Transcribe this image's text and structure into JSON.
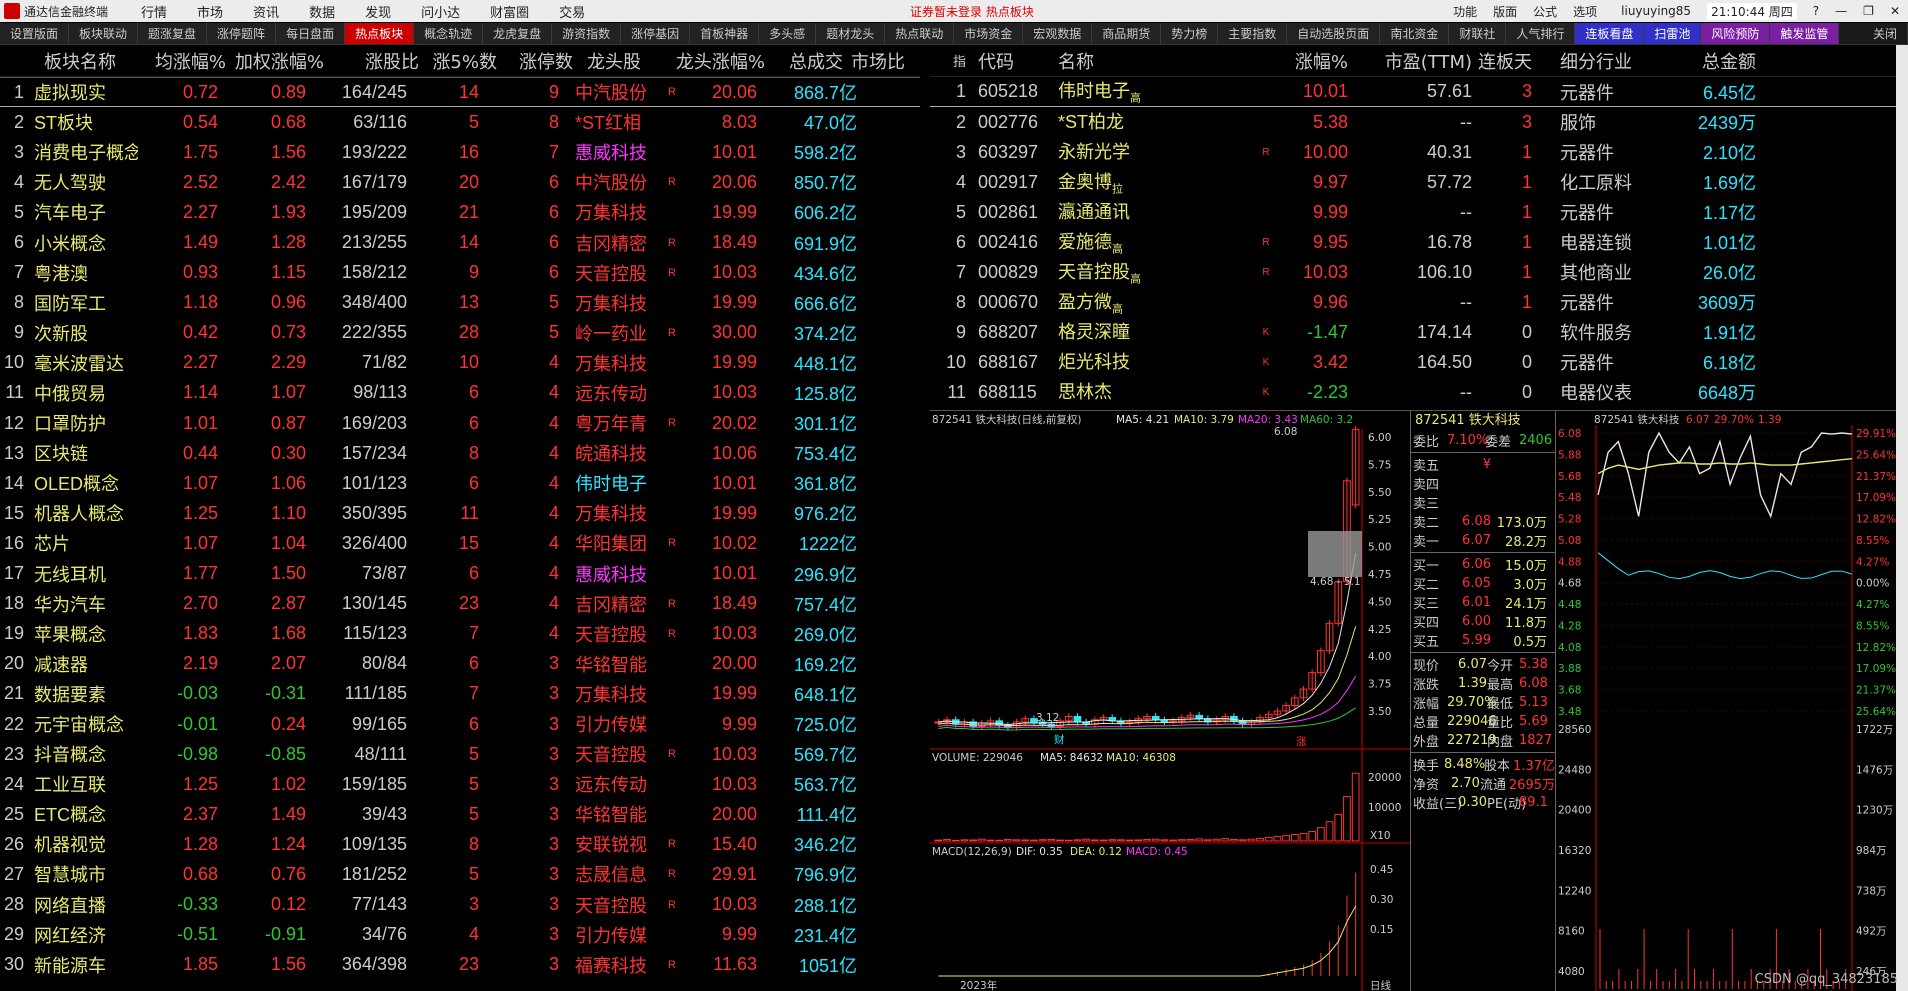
{
  "app": {
    "title": "通达信金融终端",
    "notice": "证券暂未登录  热点板块",
    "user": "liuyuying85",
    "clock": "21:10:44 周四",
    "menus": [
      "行情",
      "市场",
      "资讯",
      "数据",
      "发现",
      "问小达",
      "财富圈",
      "交易"
    ],
    "right_menus": [
      "功能",
      "版面",
      "公式",
      "选项"
    ]
  },
  "tabs": [
    "设置版面",
    "板块联动",
    "题涨复盘",
    "涨停题阵",
    "每日盘面",
    "热点板块",
    "概念轨迹",
    "龙虎复盘",
    "游资指数",
    "涨停基因",
    "首板神器",
    "多头感",
    "题材龙头",
    "热点联动",
    "市场资金",
    "宏观数据",
    "商品期货",
    "势力榜",
    "主要指数",
    "自动选股页面",
    "南北资金",
    "财联社",
    "人气排行",
    "连板看盘",
    "扫雷池",
    "风险预防",
    "触发监管",
    "关闭"
  ],
  "left": {
    "headers": {
      "name": "板块名称",
      "avg": "均涨幅%",
      "w": "加权涨幅%",
      "ratio": "涨股比",
      "z5": "涨5%数",
      "zt": "涨停数",
      "leader": "龙头股",
      "lz": "龙头涨幅%",
      "amt": "总成交",
      "extra": "市场比"
    },
    "rows": [
      {
        "i": "1",
        "n": "虚拟现实",
        "a": "0.72",
        "w": "0.89",
        "r": "164/245",
        "z5": "14",
        "zt": "9",
        "l": "中汽股份",
        "m": "R",
        "lz": "20.06",
        "amt": "868.7亿"
      },
      {
        "i": "2",
        "n": "ST板块",
        "a": "0.54",
        "w": "0.68",
        "r": "63/116",
        "z5": "5",
        "zt": "8",
        "l": "*ST红相",
        "m": "",
        "lz": "8.03",
        "amt": "47.0亿"
      },
      {
        "i": "3",
        "n": "消费电子概念",
        "a": "1.75",
        "w": "1.56",
        "r": "193/222",
        "z5": "16",
        "zt": "7",
        "l": "惠威科技",
        "m": "",
        "lz": "10.01",
        "amt": "598.2亿"
      },
      {
        "i": "4",
        "n": "无人驾驶",
        "a": "2.52",
        "w": "2.42",
        "r": "167/179",
        "z5": "20",
        "zt": "6",
        "l": "中汽股份",
        "m": "R",
        "lz": "20.06",
        "amt": "850.7亿"
      },
      {
        "i": "5",
        "n": "汽车电子",
        "a": "2.27",
        "w": "1.93",
        "r": "195/209",
        "z5": "21",
        "zt": "6",
        "l": "万集科技",
        "m": "",
        "lz": "19.99",
        "amt": "606.2亿"
      },
      {
        "i": "6",
        "n": "小米概念",
        "a": "1.49",
        "w": "1.28",
        "r": "213/255",
        "z5": "14",
        "zt": "6",
        "l": "吉冈精密",
        "m": "R",
        "lz": "18.49",
        "amt": "691.9亿"
      },
      {
        "i": "7",
        "n": "粤港澳",
        "a": "0.93",
        "w": "1.15",
        "r": "158/212",
        "z5": "9",
        "zt": "6",
        "l": "天音控股",
        "m": "R",
        "lz": "10.03",
        "amt": "434.6亿"
      },
      {
        "i": "8",
        "n": "国防军工",
        "a": "1.18",
        "w": "0.96",
        "r": "348/400",
        "z5": "13",
        "zt": "5",
        "l": "万集科技",
        "m": "",
        "lz": "19.99",
        "amt": "666.6亿"
      },
      {
        "i": "9",
        "n": "次新股",
        "a": "0.42",
        "w": "0.73",
        "r": "222/355",
        "z5": "28",
        "zt": "5",
        "l": "岭一药业",
        "m": "R",
        "lz": "30.00",
        "amt": "374.2亿"
      },
      {
        "i": "10",
        "n": "毫米波雷达",
        "a": "2.27",
        "w": "2.29",
        "r": "71/82",
        "z5": "10",
        "zt": "4",
        "l": "万集科技",
        "m": "",
        "lz": "19.99",
        "amt": "448.1亿"
      },
      {
        "i": "11",
        "n": "中俄贸易",
        "a": "1.14",
        "w": "1.07",
        "r": "98/113",
        "z5": "6",
        "zt": "4",
        "l": "远东传动",
        "m": "",
        "lz": "10.03",
        "amt": "125.8亿"
      },
      {
        "i": "12",
        "n": "口罩防护",
        "a": "1.01",
        "w": "0.87",
        "r": "169/203",
        "z5": "6",
        "zt": "4",
        "l": "粤万年青",
        "m": "R",
        "lz": "20.02",
        "amt": "301.1亿"
      },
      {
        "i": "13",
        "n": "区块链",
        "a": "0.44",
        "w": "0.30",
        "r": "157/234",
        "z5": "8",
        "zt": "4",
        "l": "皖通科技",
        "m": "",
        "lz": "10.06",
        "amt": "753.4亿"
      },
      {
        "i": "14",
        "n": "OLED概念",
        "a": "1.07",
        "w": "1.06",
        "r": "101/123",
        "z5": "6",
        "zt": "4",
        "l": "伟时电子",
        "m": "",
        "lz": "10.01",
        "amt": "361.8亿"
      },
      {
        "i": "15",
        "n": "机器人概念",
        "a": "1.25",
        "w": "1.10",
        "r": "350/395",
        "z5": "11",
        "zt": "4",
        "l": "万集科技",
        "m": "",
        "lz": "19.99",
        "amt": "976.2亿"
      },
      {
        "i": "16",
        "n": "芯片",
        "a": "1.07",
        "w": "1.04",
        "r": "326/400",
        "z5": "15",
        "zt": "4",
        "l": "华阳集团",
        "m": "R",
        "lz": "10.02",
        "amt": "1222亿"
      },
      {
        "i": "17",
        "n": "无线耳机",
        "a": "1.77",
        "w": "1.50",
        "r": "73/87",
        "z5": "6",
        "zt": "4",
        "l": "惠威科技",
        "m": "",
        "lz": "10.01",
        "amt": "296.9亿"
      },
      {
        "i": "18",
        "n": "华为汽车",
        "a": "2.70",
        "w": "2.87",
        "r": "130/145",
        "z5": "23",
        "zt": "4",
        "l": "吉冈精密",
        "m": "R",
        "lz": "18.49",
        "amt": "757.4亿"
      },
      {
        "i": "19",
        "n": "苹果概念",
        "a": "1.83",
        "w": "1.68",
        "r": "115/123",
        "z5": "7",
        "zt": "4",
        "l": "天音控股",
        "m": "R",
        "lz": "10.03",
        "amt": "269.0亿"
      },
      {
        "i": "20",
        "n": "减速器",
        "a": "2.19",
        "w": "2.07",
        "r": "80/84",
        "z5": "6",
        "zt": "3",
        "l": "华铭智能",
        "m": "",
        "lz": "20.00",
        "amt": "169.2亿"
      },
      {
        "i": "21",
        "n": "数据要素",
        "a": "-0.03",
        "w": "-0.31",
        "r": "111/185",
        "z5": "7",
        "zt": "3",
        "l": "万集科技",
        "m": "",
        "lz": "19.99",
        "amt": "648.1亿"
      },
      {
        "i": "22",
        "n": "元宇宙概念",
        "a": "-0.01",
        "w": "0.24",
        "r": "99/165",
        "z5": "6",
        "zt": "3",
        "l": "引力传媒",
        "m": "",
        "lz": "9.99",
        "amt": "725.0亿"
      },
      {
        "i": "23",
        "n": "抖音概念",
        "a": "-0.98",
        "w": "-0.85",
        "r": "48/111",
        "z5": "5",
        "zt": "3",
        "l": "天音控股",
        "m": "R",
        "lz": "10.03",
        "amt": "569.7亿"
      },
      {
        "i": "24",
        "n": "工业互联",
        "a": "1.25",
        "w": "1.02",
        "r": "159/185",
        "z5": "5",
        "zt": "3",
        "l": "远东传动",
        "m": "",
        "lz": "10.03",
        "amt": "563.7亿"
      },
      {
        "i": "25",
        "n": "ETC概念",
        "a": "2.37",
        "w": "1.49",
        "r": "39/43",
        "z5": "5",
        "zt": "3",
        "l": "华铭智能",
        "m": "",
        "lz": "20.00",
        "amt": "111.4亿"
      },
      {
        "i": "26",
        "n": "机器视觉",
        "a": "1.28",
        "w": "1.24",
        "r": "109/135",
        "z5": "8",
        "zt": "3",
        "l": "安联锐视",
        "m": "R",
        "lz": "15.40",
        "amt": "346.2亿"
      },
      {
        "i": "27",
        "n": "智慧城市",
        "a": "0.68",
        "w": "0.76",
        "r": "181/252",
        "z5": "5",
        "zt": "3",
        "l": "志晟信息",
        "m": "R",
        "lz": "29.91",
        "amt": "796.9亿"
      },
      {
        "i": "28",
        "n": "网络直播",
        "a": "-0.33",
        "w": "0.12",
        "r": "77/143",
        "z5": "3",
        "zt": "3",
        "l": "天音控股",
        "m": "R",
        "lz": "10.03",
        "amt": "288.1亿"
      },
      {
        "i": "29",
        "n": "网红经济",
        "a": "-0.51",
        "w": "-0.91",
        "r": "34/76",
        "z5": "4",
        "zt": "3",
        "l": "引力传媒",
        "m": "",
        "lz": "9.99",
        "amt": "231.4亿"
      },
      {
        "i": "30",
        "n": "新能源车",
        "a": "1.85",
        "w": "1.56",
        "r": "364/398",
        "z5": "23",
        "zt": "3",
        "l": "福赛科技",
        "m": "R",
        "lz": "11.63",
        "amt": "1051亿"
      }
    ]
  },
  "right": {
    "headers": {
      "idx": "指",
      "code": "代码",
      "name": "名称",
      "chg": "涨幅%",
      "pe": "市盈(TTM)",
      "days": "连板天",
      "ind": "细分行业",
      "amt": "总金额"
    },
    "rows": [
      {
        "i": "1",
        "code": "605218",
        "n": "伟时电子",
        "sub": "高",
        "m": "",
        "chg": "10.01",
        "pe": "57.61",
        "d": "3",
        "ind": "元器件",
        "amt": "6.45亿"
      },
      {
        "i": "2",
        "code": "002776",
        "n": "*ST柏龙",
        "sub": "",
        "m": "",
        "chg": "5.38",
        "pe": "--",
        "d": "3",
        "ind": "服饰",
        "amt": "2439万"
      },
      {
        "i": "3",
        "code": "603297",
        "n": "永新光学",
        "sub": "",
        "m": "R",
        "chg": "10.00",
        "pe": "40.31",
        "d": "1",
        "ind": "元器件",
        "amt": "2.10亿"
      },
      {
        "i": "4",
        "code": "002917",
        "n": "金奥博",
        "sub": "拉",
        "m": "",
        "chg": "9.97",
        "pe": "57.72",
        "d": "1",
        "ind": "化工原料",
        "amt": "1.69亿"
      },
      {
        "i": "5",
        "code": "002861",
        "n": "瀛通通讯",
        "sub": "",
        "m": "",
        "chg": "9.99",
        "pe": "--",
        "d": "1",
        "ind": "元器件",
        "amt": "1.17亿"
      },
      {
        "i": "6",
        "code": "002416",
        "n": "爱施德",
        "sub": "高",
        "m": "R",
        "chg": "9.95",
        "pe": "16.78",
        "d": "1",
        "ind": "电器连锁",
        "amt": "1.01亿"
      },
      {
        "i": "7",
        "code": "000829",
        "n": "天音控股",
        "sub": "高",
        "m": "R",
        "chg": "10.03",
        "pe": "106.10",
        "d": "1",
        "ind": "其他商业",
        "amt": "26.0亿"
      },
      {
        "i": "8",
        "code": "000670",
        "n": "盈方微",
        "sub": "高",
        "m": "",
        "chg": "9.96",
        "pe": "--",
        "d": "1",
        "ind": "元器件",
        "amt": "3609万"
      },
      {
        "i": "9",
        "code": "688207",
        "n": "格灵深瞳",
        "sub": "",
        "m": "K",
        "chg": "-1.47",
        "pe": "174.14",
        "d": "0",
        "ind": "软件服务",
        "amt": "1.91亿"
      },
      {
        "i": "10",
        "code": "688167",
        "n": "炬光科技",
        "sub": "",
        "m": "K",
        "chg": "3.42",
        "pe": "164.50",
        "d": "0",
        "ind": "元器件",
        "amt": "6.18亿"
      },
      {
        "i": "11",
        "code": "688115",
        "n": "思林杰",
        "sub": "",
        "m": "K",
        "chg": "-2.23",
        "pe": "--",
        "d": "0",
        "ind": "电器仪表",
        "amt": "6648万"
      }
    ]
  },
  "kline": {
    "title": "872541 铁大科技(日线,前复权)",
    "ma5": "MA5: 4.21",
    "ma10": "MA10: 3.79",
    "ma20": "MA20: 3.43",
    "ma60": "MA60: 3.2",
    "yticks": [
      "6.00",
      "5.75",
      "5.50",
      "5.25",
      "5.00",
      "4.75",
      "4.50",
      "4.25",
      "4.00",
      "3.75",
      "3.50"
    ],
    "high_label": "6.08",
    "low_label": "3.12",
    "box_label": "4.68 - 5.1",
    "marker_cai": "财",
    "marker_zhang": "涨",
    "vol_title": "VOLUME: 229046",
    "vol_ma5": "MA5: 84632",
    "vol_ma10": "MA10: 46308",
    "vol_yticks": [
      "20000",
      "10000"
    ],
    "vol_unit": "X10",
    "macd_title": "MACD(12,26,9)",
    "macd_dif": "DIF: 0.35",
    "macd_dea": "DEA: 0.12",
    "macd_val": "MACD: 0.45",
    "macd_yticks": [
      "0.45",
      "0.30",
      "0.15"
    ],
    "year_label": "2023年",
    "day_label": "日线",
    "closes": [
      3.4,
      3.42,
      3.38,
      3.4,
      3.36,
      3.39,
      3.41,
      3.37,
      3.35,
      3.4,
      3.43,
      3.4,
      3.38,
      3.36,
      3.41,
      3.45,
      3.4,
      3.38,
      3.42,
      3.44,
      3.41,
      3.39,
      3.4,
      3.43,
      3.45,
      3.42,
      3.4,
      3.41,
      3.44,
      3.46,
      3.43,
      3.4,
      3.42,
      3.45,
      3.41,
      3.38,
      3.4,
      3.44,
      3.47,
      3.5,
      3.55,
      3.62,
      3.7,
      3.85,
      4.05,
      4.3,
      4.68,
      5.6,
      6.07
    ],
    "volumes": [
      300,
      500,
      200,
      400,
      350,
      600,
      300,
      250,
      500,
      400,
      350,
      300,
      450,
      500,
      300,
      250,
      400,
      600,
      350,
      300,
      450,
      400,
      300,
      350,
      500,
      600,
      400,
      300,
      450,
      500,
      700,
      400,
      600,
      800,
      500,
      400,
      600,
      900,
      1200,
      1500,
      1800,
      2200,
      2500,
      3200,
      4500,
      6500,
      9000,
      15000,
      22904
    ],
    "macd": [
      0,
      0,
      0,
      0,
      0,
      0,
      0,
      0,
      0,
      0,
      0,
      0,
      0,
      0,
      0,
      0,
      0,
      0,
      0,
      0,
      0,
      0,
      0,
      0,
      0,
      0,
      0,
      0,
      0,
      0,
      0,
      0,
      0,
      0,
      0,
      0,
      0,
      0,
      0.01,
      0.02,
      0.03,
      0.04,
      0.05,
      0.07,
      0.1,
      0.15,
      0.22,
      0.35,
      0.45
    ]
  },
  "quote": {
    "title": "872541 铁大科技",
    "webi": "委比",
    "webi_v": "7.10%",
    "weca": "委差",
    "weca_v": "2406",
    "asks": [
      {
        "l": "卖五",
        "p": "¥",
        "v": ""
      },
      {
        "l": "卖四",
        "p": "",
        "v": ""
      },
      {
        "l": "卖三",
        "p": "",
        "v": ""
      },
      {
        "l": "卖二",
        "p": "6.08",
        "v": "173.0万"
      },
      {
        "l": "卖一",
        "p": "6.07",
        "v": "28.2万"
      }
    ],
    "bids": [
      {
        "l": "买一",
        "p": "6.06",
        "v": "15.0万"
      },
      {
        "l": "买二",
        "p": "6.05",
        "v": "3.0万"
      },
      {
        "l": "买三",
        "p": "6.01",
        "v": "24.1万"
      },
      {
        "l": "买四",
        "p": "6.00",
        "v": "11.8万"
      },
      {
        "l": "买五",
        "p": "5.99",
        "v": "0.5万"
      }
    ],
    "stats": [
      {
        "a": "现价",
        "av": "6.07",
        "b": "今开",
        "bv": "5.38"
      },
      {
        "a": "涨跌",
        "av": "1.39",
        "b": "最高",
        "bv": "6.08"
      },
      {
        "a": "涨幅",
        "av": "29.70%",
        "b": "最低",
        "bv": "5.13"
      },
      {
        "a": "总量",
        "av": "229046",
        "b": "量比",
        "bv": "5.69"
      },
      {
        "a": "外盘",
        "av": "227219",
        "b": "内盘",
        "bv": "1827"
      }
    ],
    "stats2": [
      {
        "a": "换手",
        "av": "8.48%",
        "b": "股本",
        "bv": "1.37亿"
      },
      {
        "a": "净资",
        "av": "2.70",
        "b": "流通",
        "bv": "2695万"
      },
      {
        "a": "收益(三)",
        "av": "0.30",
        "b": "PE(动)",
        "bv": "89.1"
      }
    ]
  },
  "minute": {
    "title": "872541 铁大科技",
    "price": "6.07",
    "pct": "29.70%",
    "chg": "1.39",
    "left_ticks": [
      "6.08",
      "5.88",
      "5.68",
      "5.48",
      "5.28",
      "5.08",
      "4.88",
      "4.68",
      "4.48",
      "4.28",
      "4.08",
      "3.88",
      "3.68",
      "3.48"
    ],
    "right_ticks": [
      "29.91%",
      "25.64%",
      "21.37%",
      "17.09%",
      "12.82%",
      "8.55%",
      "4.27%",
      "0.00%",
      "4.27%",
      "8.55%",
      "12.82%",
      "17.09%",
      "21.37%",
      "25.64%"
    ],
    "vol_left": [
      "28560",
      "24480",
      "20400",
      "16320",
      "12240",
      "8160",
      "4080"
    ],
    "vol_right": [
      "1722万",
      "1476万",
      "1230万",
      "984万",
      "738万",
      "492万",
      "246万"
    ],
    "prices": [
      5.5,
      5.9,
      6.0,
      5.7,
      5.3,
      5.9,
      6.08,
      5.9,
      5.8,
      5.95,
      5.7,
      5.75,
      6.0,
      5.6,
      5.85,
      6.05,
      5.5,
      5.3,
      5.7,
      5.6,
      5.9,
      5.95,
      6.08,
      6.07,
      6.08,
      6.07
    ],
    "avg": [
      5.7,
      5.75,
      5.78,
      5.76,
      5.74,
      5.76,
      5.78,
      5.79,
      5.8,
      5.8,
      5.79,
      5.79,
      5.8,
      5.79,
      5.79,
      5.8,
      5.79,
      5.78,
      5.78,
      5.78,
      5.79,
      5.8,
      5.81,
      5.82,
      5.83,
      5.84
    ]
  },
  "watermark": "CSDN @qq_34823185"
}
